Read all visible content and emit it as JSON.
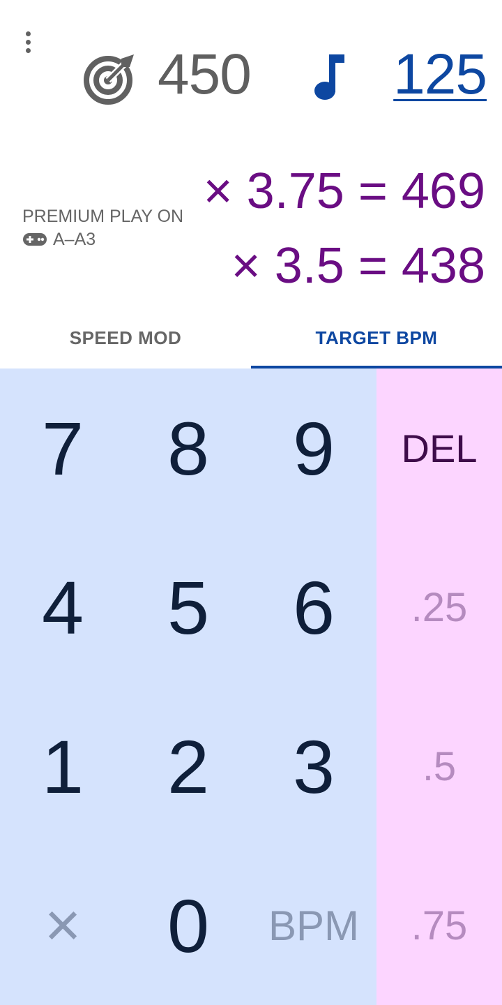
{
  "header": {
    "target_value": "450",
    "bpm_value": "125"
  },
  "premium": {
    "line1": "PREMIUM PLAY ON",
    "line2": "A–A3"
  },
  "calcs": [
    {
      "text": "× 3.75 = 469"
    },
    {
      "text": "× 3.5 = 438"
    }
  ],
  "tabs": [
    {
      "label": "SPEED MOD",
      "active": false
    },
    {
      "label": "TARGET BPM",
      "active": true
    }
  ],
  "keypad": {
    "k7": "7",
    "k8": "8",
    "k9": "9",
    "del": "DEL",
    "k4": "4",
    "k5": "5",
    "k6": "6",
    "q25": ".25",
    "k1": "1",
    "k2": "2",
    "k3": "3",
    "q5": ".5",
    "times": "×",
    "k0": "0",
    "bpm": "BPM",
    "q75": ".75"
  },
  "colors": {
    "accent_blue": "#0d47a1",
    "calc_purple": "#6a0d83",
    "pad_blue": "#d5e3fd",
    "pad_pink": "#fcd5ff"
  },
  "icons": {
    "menu": "more-vert-icon",
    "target": "target-icon",
    "note": "music-note-icon",
    "gamepad": "gamepad-icon"
  }
}
